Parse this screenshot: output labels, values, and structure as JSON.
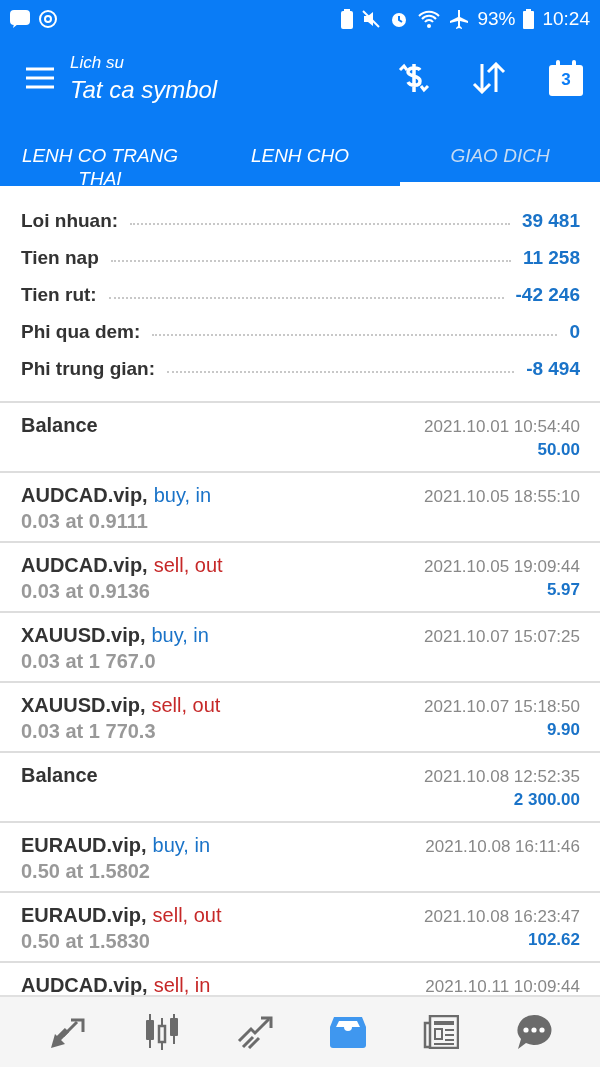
{
  "status_bar": {
    "battery": "93%",
    "time": "10:24"
  },
  "header": {
    "subtitle": "Lich su",
    "title": "Tat ca symbol",
    "calendar_day": "3"
  },
  "tabs": [
    {
      "label": "LENH CO TRANG THAI",
      "selected": false
    },
    {
      "label": "LENH CHO",
      "selected": false
    },
    {
      "label": "GIAO DICH",
      "selected": true
    }
  ],
  "summary": [
    {
      "label": "Loi nhuan:",
      "value": "39 481"
    },
    {
      "label": "Tien nap",
      "value": "11 258"
    },
    {
      "label": "Tien rut:",
      "value": "-42 246"
    },
    {
      "label": "Phi qua dem:",
      "value": "0"
    },
    {
      "label": "Phi trung gian:",
      "value": "-8 494"
    }
  ],
  "deals": [
    {
      "kind": "balance",
      "symbol": "Balance",
      "time": "2021.10.01 10:54:40",
      "profit": "50.00"
    },
    {
      "kind": "buy",
      "symbol": "AUDCAD.vip,",
      "side": "buy, in",
      "volume": "0.03 at 0.9111",
      "time": "2021.10.05 18:55:10"
    },
    {
      "kind": "sell",
      "symbol": "AUDCAD.vip,",
      "side": "sell, out",
      "volume": "0.03 at 0.9136",
      "time": "2021.10.05 19:09:44",
      "profit": "5.97"
    },
    {
      "kind": "buy",
      "symbol": "XAUUSD.vip,",
      "side": "buy, in",
      "volume": "0.03 at 1 767.0",
      "time": "2021.10.07 15:07:25"
    },
    {
      "kind": "sell",
      "symbol": "XAUUSD.vip,",
      "side": "sell, out",
      "volume": "0.03 at 1 770.3",
      "time": "2021.10.07 15:18:50",
      "profit": "9.90"
    },
    {
      "kind": "balance",
      "symbol": "Balance",
      "time": "2021.10.08 12:52:35",
      "profit": "2 300.00"
    },
    {
      "kind": "buy",
      "symbol": "EURAUD.vip,",
      "side": "buy, in",
      "volume": "0.50 at 1.5802",
      "time": "2021.10.08 16:11:46"
    },
    {
      "kind": "sell",
      "symbol": "EURAUD.vip,",
      "side": "sell, out",
      "volume": "0.50 at 1.5830",
      "time": "2021.10.08 16:23:47",
      "profit": "102.62"
    },
    {
      "kind": "sell",
      "symbol": "AUDCAD.vip,",
      "side": "sell, in",
      "time": "2021.10.11 10:09:44"
    }
  ],
  "bottom_nav": [
    {
      "selected": false
    },
    {
      "selected": false
    },
    {
      "selected": false
    },
    {
      "selected": true
    },
    {
      "selected": false
    },
    {
      "selected": false
    }
  ]
}
